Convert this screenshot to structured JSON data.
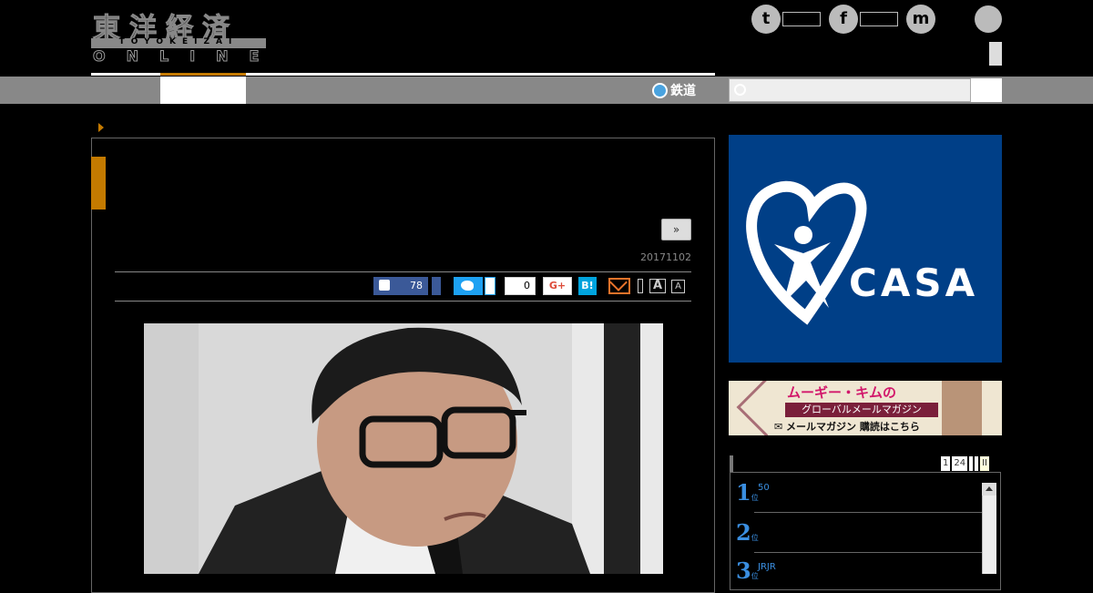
{
  "logo": {
    "kanji": "東洋経済",
    "sub": "TOYOKEIZAI",
    "online": "ONLINE"
  },
  "social": {
    "twitter_glyph": "t",
    "facebook_glyph": "f",
    "messenger_glyph": "m"
  },
  "nav": {
    "rail_label": "鉄道"
  },
  "article": {
    "next_label": "»",
    "date": "20171102",
    "like_count": "78",
    "pocket_count": "0",
    "gplus_label": "G+",
    "hatena_label": "B!",
    "font_big_label": "A",
    "font_small_label": "A"
  },
  "ads": {
    "casa_text": "CASA",
    "mail_top": "ムーギー・キムの",
    "mail_mid": "グローバルメールマガジン",
    "mail_bottom": "✉ メールマガジン 購読はこちら"
  },
  "ranking": {
    "tabs": [
      "1",
      "24",
      "",
      "",
      "ΙΙ"
    ],
    "items": [
      {
        "rank": "1",
        "unit": "位",
        "text": "50"
      },
      {
        "rank": "2",
        "unit": "位",
        "text": ""
      },
      {
        "rank": "3",
        "unit": "位",
        "text": "JRJR"
      }
    ]
  },
  "colors": {
    "accent": "#c47a00",
    "facebook": "#3b5998",
    "twitter": "#1da1f2",
    "hatena": "#00a4de",
    "casa_bg": "#003f87",
    "rank_blue": "#3a8ee0"
  }
}
